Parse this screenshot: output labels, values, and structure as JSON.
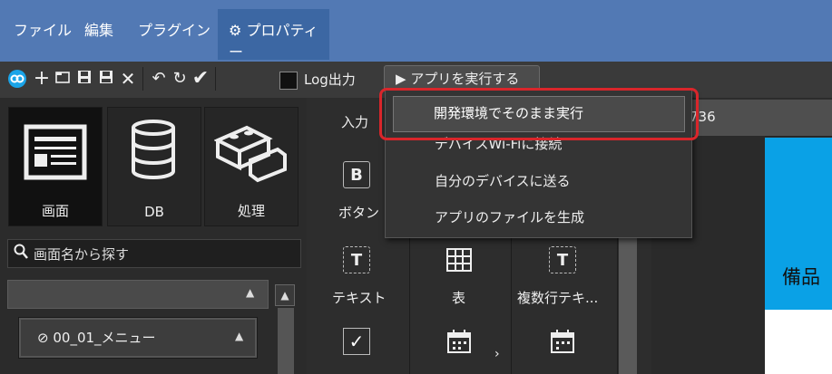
{
  "menubar": {
    "items": [
      "ファイル",
      "編集",
      "プラグイン"
    ],
    "properties": "プロパティー",
    "properties_icon": "gear-icon"
  },
  "toolbar": {
    "icons": [
      "link-icon",
      "plus-icon",
      "folder-icon",
      "save-icon",
      "save-as-icon",
      "close-icon",
      "undo-icon",
      "refresh-icon",
      "check-icon"
    ],
    "log_label": "Log出力",
    "run_label": "アプリを実行する",
    "run_icon": "play-icon"
  },
  "categories": [
    {
      "label": "画面",
      "icon": "screen-icon",
      "selected": true
    },
    {
      "label": "DB",
      "icon": "database-icon",
      "selected": false
    },
    {
      "label": "処理",
      "icon": "blocks-icon",
      "selected": false
    }
  ],
  "search": {
    "placeholder": "画面名から探す",
    "icon": "search-icon"
  },
  "screen_list": {
    "combo_value": "",
    "menu_item": "00_01_メニュー"
  },
  "palette": {
    "header": "入力",
    "items": [
      {
        "label": "ボタン",
        "icon": "B"
      },
      {
        "label": "テキスト",
        "icon": "T"
      },
      {
        "label": "表",
        "icon": "table-icon"
      },
      {
        "label": "複数行テキ...",
        "icon": "T"
      }
    ]
  },
  "inputbar": {
    "value": "736"
  },
  "preview": {
    "text": "備品"
  },
  "dropdown": {
    "items": [
      "開発環境でそのまま実行",
      "デバイスWi-Fiに接続",
      "自分のデバイスに送る",
      "アプリのファイルを生成"
    ],
    "highlighted": 0,
    "annotation_color": "#d9262b"
  },
  "colors": {
    "menubar": "#5279b4",
    "preview": "#0aa1e6",
    "annotation": "#d9262b"
  }
}
